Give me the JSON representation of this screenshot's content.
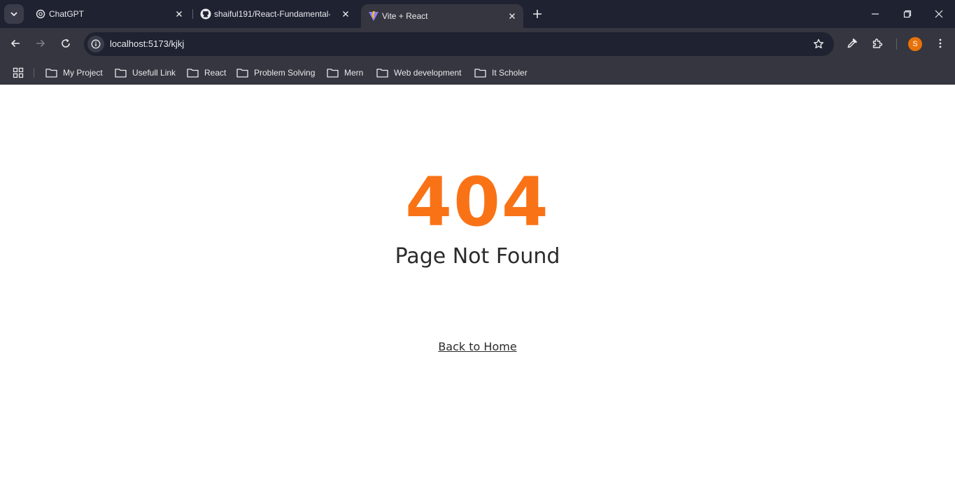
{
  "browser": {
    "tabs": [
      {
        "title": "ChatGPT",
        "icon": "chatgpt-icon"
      },
      {
        "title": "shaiful191/React-Fundamental-",
        "icon": "github-icon"
      },
      {
        "title": "Vite + React",
        "icon": "vite-icon",
        "active": true
      }
    ],
    "url": "localhost:5173/kjkj",
    "profile_initial": "S",
    "bookmarks": [
      {
        "label": "My Project"
      },
      {
        "label": "Usefull Link"
      },
      {
        "label": "React"
      },
      {
        "label": "Problem Solving"
      },
      {
        "label": "Mern"
      },
      {
        "label": "Web development"
      },
      {
        "label": "It Scholer"
      }
    ]
  },
  "page": {
    "error_code": "404",
    "message": "Page Not Found",
    "home_link": "Back to Home"
  },
  "colors": {
    "accent": "#f97316",
    "text": "#2b2b2b",
    "chrome_dark": "#1f2230",
    "chrome": "#35363f",
    "profile": "#e8710a"
  }
}
